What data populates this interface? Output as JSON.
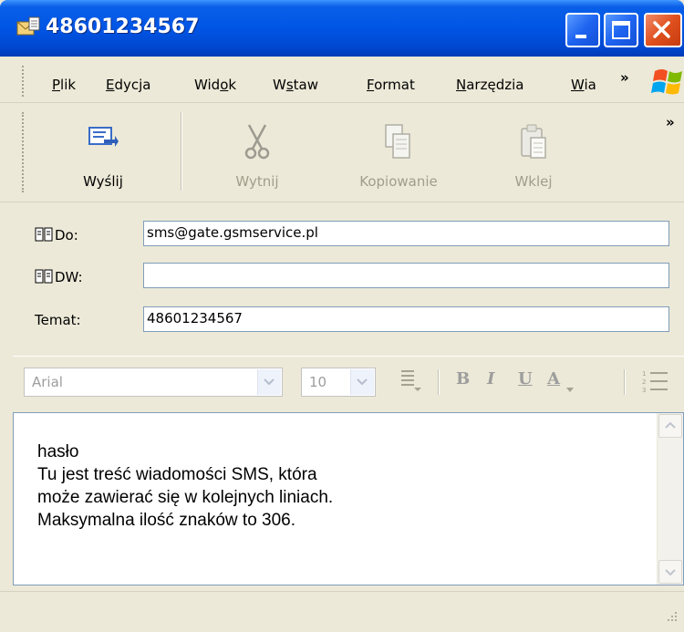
{
  "window": {
    "title": "48601234567"
  },
  "menu": {
    "items": [
      {
        "pre": "",
        "ul": "P",
        "post": "lik"
      },
      {
        "pre": "",
        "ul": "E",
        "post": "dycja"
      },
      {
        "pre": "Wid",
        "ul": "o",
        "post": "k"
      },
      {
        "pre": "W",
        "ul": "s",
        "post": "taw"
      },
      {
        "pre": "",
        "ul": "F",
        "post": "ormat"
      },
      {
        "pre": "",
        "ul": "N",
        "post": "arzędzia"
      },
      {
        "pre": "",
        "ul": "W",
        "post": "ia"
      }
    ],
    "more": "»"
  },
  "toolbar": {
    "send": "Wyślij",
    "cut": "Wytnij",
    "copy": "Kopiowanie",
    "paste": "Wklej",
    "more": "»"
  },
  "fields": {
    "to_label": "Do:",
    "to_value": "sms@gate.gsmservice.pl",
    "cc_label": "DW:",
    "cc_value": "",
    "subject_label": "Temat:",
    "subject_value": "48601234567"
  },
  "format": {
    "font": "Arial",
    "size": "10",
    "bold": "B",
    "italic": "I",
    "underline": "U",
    "color": "A"
  },
  "body": {
    "lines": [
      "hasło",
      "Tu jest treść wiadomości SMS, która",
      "może zawierać się w kolejnych liniach.",
      "Maksymalna ilość znaków to 306."
    ]
  },
  "colors": {
    "titlebar": "#0055e5",
    "chrome": "#ece9d8",
    "close_button": "#e0501e"
  }
}
